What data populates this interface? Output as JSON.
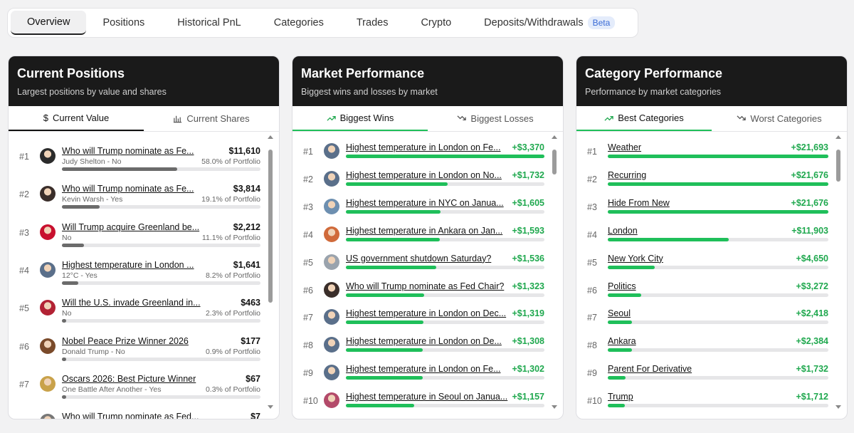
{
  "tabs": [
    {
      "label": "Overview",
      "active": true
    },
    {
      "label": "Positions"
    },
    {
      "label": "Historical PnL"
    },
    {
      "label": "Categories"
    },
    {
      "label": "Trades"
    },
    {
      "label": "Crypto"
    },
    {
      "label": "Deposits/Withdrawals",
      "badge": "Beta"
    }
  ],
  "positions": {
    "title": "Current Positions",
    "subtitle": "Largest positions by value and shares",
    "tabs": [
      "Current Value",
      "Current Shares"
    ],
    "rows": [
      {
        "rank": "#1",
        "title": "Who will Trump nominate as Fe...",
        "sub": "Judy Shelton - No",
        "value": "$11,610",
        "pct": "58.0% of Portfolio",
        "level": 0.58,
        "icon": "avatar-woman",
        "color": "#2b2b2b"
      },
      {
        "rank": "#2",
        "title": "Who will Trump nominate as Fe...",
        "sub": "Kevin Warsh - Yes",
        "value": "$3,814",
        "pct": "19.1% of Portfolio",
        "level": 0.191,
        "icon": "avatar-man",
        "color": "#3a2e2a"
      },
      {
        "rank": "#3",
        "title": "Will Trump acquire Greenland be...",
        "sub": "No",
        "value": "$2,212",
        "pct": "11.1% of Portfolio",
        "level": 0.111,
        "icon": "flag-badge",
        "color": "#c8102e"
      },
      {
        "rank": "#4",
        "title": "Highest temperature in London ...",
        "sub": "12°C - Yes",
        "value": "$1,641",
        "pct": "8.2% of Portfolio",
        "level": 0.082,
        "icon": "london-city",
        "color": "#5a6f8a"
      },
      {
        "rank": "#5",
        "title": "Will the U.S. invade Greenland in...",
        "sub": "No",
        "value": "$463",
        "pct": "2.3% of Portfolio",
        "level": 0.023,
        "icon": "us-flag",
        "color": "#b22234"
      },
      {
        "rank": "#6",
        "title": "Nobel Peace Prize Winner 2026",
        "sub": "Donald Trump - No",
        "value": "$177",
        "pct": "0.9% of Portfolio",
        "level": 0.009,
        "icon": "avatar-man",
        "color": "#7a4a2a"
      },
      {
        "rank": "#7",
        "title": "Oscars 2026: Best Picture Winner",
        "sub": "One Battle After Another - Yes",
        "value": "$67",
        "pct": "0.3% of Portfolio",
        "level": 0.003,
        "icon": "oscar-statue",
        "color": "#c9a24a"
      },
      {
        "rank": "#8",
        "title": "Who will Trump nominate as Fed...",
        "sub": "",
        "value": "$7",
        "pct": "",
        "level": 0.0,
        "icon": "avatar",
        "color": "#777"
      }
    ]
  },
  "market": {
    "title": "Market Performance",
    "subtitle": "Biggest wins and losses by market",
    "tabs": [
      "Biggest Wins",
      "Biggest Losses"
    ],
    "rows": [
      {
        "rank": "#1",
        "title": "Highest temperature in London on Fe...",
        "value": "+$3,370",
        "level": 1.0,
        "icon": "london-city",
        "color": "#5a6f8a"
      },
      {
        "rank": "#2",
        "title": "Highest temperature in London on No...",
        "value": "+$1,732",
        "level": 0.514,
        "icon": "london-city",
        "color": "#5a6f8a"
      },
      {
        "rank": "#3",
        "title": "Highest temperature in NYC on Janua...",
        "value": "+$1,605",
        "level": 0.476,
        "icon": "nyc-city",
        "color": "#6d8fb0"
      },
      {
        "rank": "#4",
        "title": "Highest temperature in Ankara on Jan...",
        "value": "+$1,593",
        "level": 0.473,
        "icon": "ankara-city",
        "color": "#d06a3a"
      },
      {
        "rank": "#5",
        "title": "US government shutdown Saturday?",
        "value": "+$1,536",
        "level": 0.456,
        "icon": "capitol",
        "color": "#9aa3ad"
      },
      {
        "rank": "#6",
        "title": "Who will Trump nominate as Fed Chair?",
        "value": "+$1,323",
        "level": 0.393,
        "icon": "avatar-man",
        "color": "#3a2e2a"
      },
      {
        "rank": "#7",
        "title": "Highest temperature in London on Dec...",
        "value": "+$1,319",
        "level": 0.391,
        "icon": "london-city",
        "color": "#5a6f8a"
      },
      {
        "rank": "#8",
        "title": "Highest temperature in London on De...",
        "value": "+$1,308",
        "level": 0.388,
        "icon": "london-city",
        "color": "#5a6f8a"
      },
      {
        "rank": "#9",
        "title": "Highest temperature in London on Fe...",
        "value": "+$1,302",
        "level": 0.386,
        "icon": "london-city",
        "color": "#5a6f8a"
      },
      {
        "rank": "#10",
        "title": "Highest temperature in Seoul on Janua...",
        "value": "+$1,157",
        "level": 0.343,
        "icon": "seoul-city",
        "color": "#b34a6a"
      }
    ]
  },
  "category": {
    "title": "Category Performance",
    "subtitle": "Performance by market categories",
    "tabs": [
      "Best Categories",
      "Worst Categories"
    ],
    "rows": [
      {
        "rank": "#1",
        "title": "Weather",
        "value": "+$21,693",
        "level": 1.0
      },
      {
        "rank": "#2",
        "title": "Recurring",
        "value": "+$21,676",
        "level": 0.999
      },
      {
        "rank": "#3",
        "title": "Hide From New",
        "value": "+$21,676",
        "level": 0.999
      },
      {
        "rank": "#4",
        "title": "London",
        "value": "+$11,903",
        "level": 0.549
      },
      {
        "rank": "#5",
        "title": "New York City",
        "value": "+$4,650",
        "level": 0.214
      },
      {
        "rank": "#6",
        "title": "Politics",
        "value": "+$3,272",
        "level": 0.151
      },
      {
        "rank": "#7",
        "title": "Seoul",
        "value": "+$2,418",
        "level": 0.111
      },
      {
        "rank": "#8",
        "title": "Ankara",
        "value": "+$2,384",
        "level": 0.11
      },
      {
        "rank": "#9",
        "title": "Parent For Derivative",
        "value": "+$1,732",
        "level": 0.08
      },
      {
        "rank": "#10",
        "title": "Trump",
        "value": "+$1,712",
        "level": 0.079
      }
    ]
  }
}
